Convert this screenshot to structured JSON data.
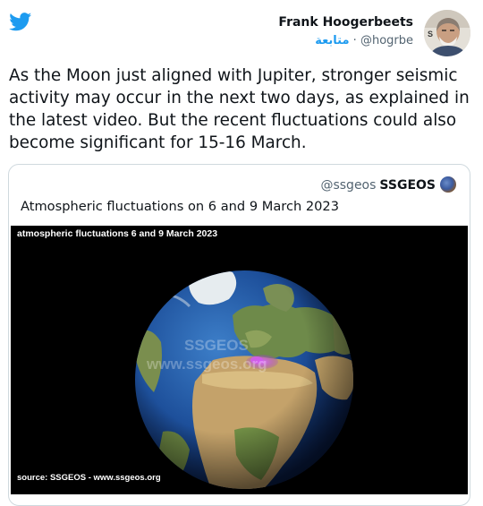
{
  "author": {
    "name": "Frank Hoogerbeets",
    "follow_label": "متابعة",
    "separator": "·",
    "handle": "@hogrbe"
  },
  "icons": {
    "brand": "twitter-bird-icon",
    "quoted_avatar": "ssgeos-avatar-icon"
  },
  "tweet": {
    "text": "As the Moon just aligned with Jupiter, stronger seismic activity may occur in the next two days, as explained in the latest video. But the recent fluctuations could also become significant for 15-16 March."
  },
  "quoted": {
    "handle": "@ssgeos",
    "name": "SSGEOS",
    "text": "Atmospheric fluctuations on 6 and 9 March 2023",
    "media": {
      "title": "atmospheric fluctuations 6 and 9 March 2023",
      "source": "source: SSGEOS - www.ssgeos.org",
      "watermark_lines": [
        "SSGEOS",
        "www.ssgeos.org"
      ]
    }
  },
  "colors": {
    "brand_blue": "#1d9bf0",
    "text": "#0f1419",
    "muted": "#536471",
    "border": "#cfd9de",
    "anomaly": "#b040e0"
  }
}
